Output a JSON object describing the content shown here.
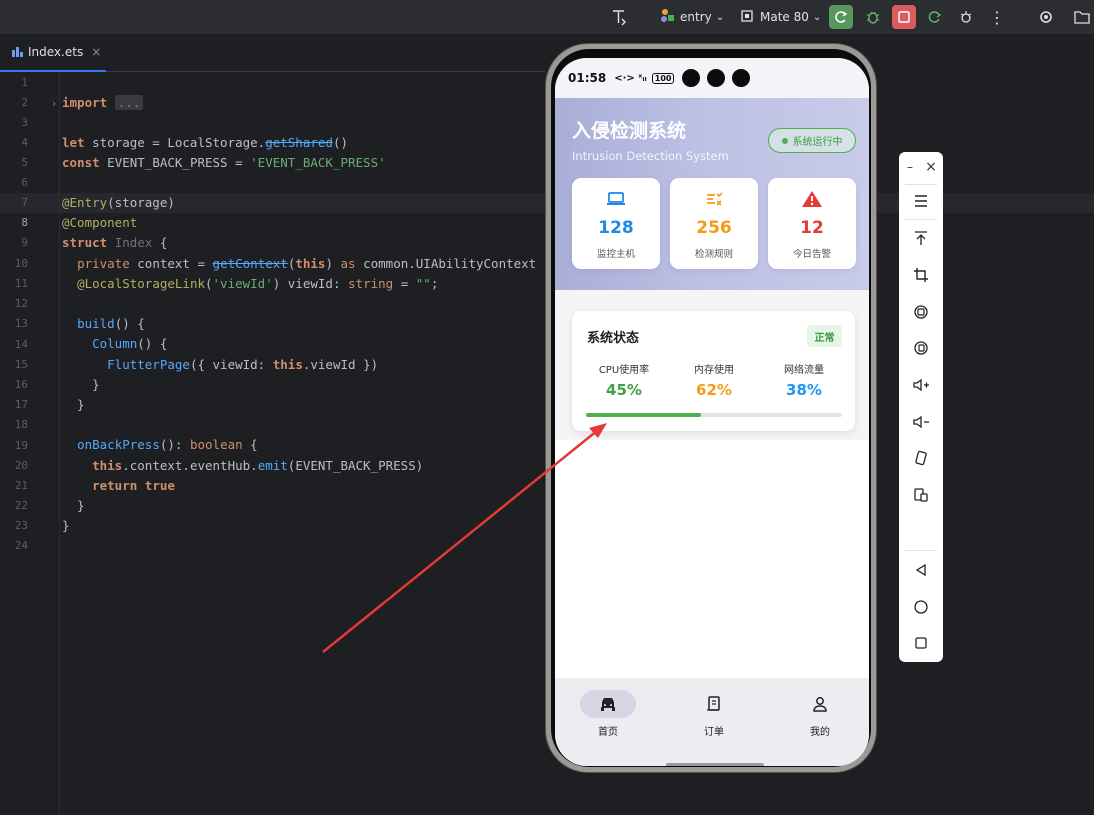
{
  "toolbar": {
    "module": "entry",
    "device": "Mate 80",
    "icons": [
      "text-tool-icon",
      "module-icon",
      "device-icon",
      "run-icon",
      "debug-icon",
      "stop-icon",
      "apply-changes-icon",
      "profiler-icon",
      "more-icon",
      "settings-icon",
      "folder-icon"
    ]
  },
  "editor": {
    "tab": {
      "label": "Index.ets",
      "close": "×"
    },
    "fold_placeholder": "...",
    "line_numbers": [
      "1",
      "2",
      "3",
      "4",
      "5",
      "6",
      "7",
      "8",
      "9",
      "10",
      "11",
      "12",
      "13",
      "14",
      "15",
      "16",
      "17",
      "18",
      "19",
      "20",
      "21",
      "22",
      "23",
      "24"
    ]
  },
  "phone": {
    "status": {
      "time": "01:58",
      "icons": "<·> ˣᵢₗ",
      "battery": "100"
    },
    "header": {
      "title": "入侵检测系统",
      "subtitle": "Intrusion Detection System",
      "running_badge": "系统运行中"
    },
    "stats": [
      {
        "icon": "laptop-icon",
        "value": "128",
        "label": "监控主机",
        "color": "#1e88e5"
      },
      {
        "icon": "rules-icon",
        "value": "256",
        "label": "检测规则",
        "color": "#f39c12"
      },
      {
        "icon": "warning-icon",
        "value": "12",
        "label": "今日告警",
        "color": "#e53935"
      }
    ],
    "system_status": {
      "title": "系统状态",
      "badge": "正常",
      "metrics": [
        {
          "label": "CPU使用率",
          "value": "45%",
          "color": "#43a047"
        },
        {
          "label": "内存使用",
          "value": "62%",
          "color": "#f39c12"
        },
        {
          "label": "网络流量",
          "value": "38%",
          "color": "#2196f3"
        }
      ],
      "progress": 0.45
    },
    "bottom_nav": [
      {
        "icon": "car-icon",
        "label": "首页",
        "active": true
      },
      {
        "icon": "receipt-icon",
        "label": "订单",
        "active": false
      },
      {
        "icon": "person-icon",
        "label": "我的",
        "active": false
      }
    ]
  },
  "side_panel": {
    "minimize": "–",
    "close": "×",
    "tools": [
      "menu-icon",
      "pin-top-icon",
      "crop-icon",
      "rotate-left-icon",
      "rotate-right-icon",
      "volume-up-icon",
      "volume-down-icon",
      "shake-icon",
      "multi-device-icon",
      "back-icon",
      "home-icon",
      "recent-apps-icon"
    ]
  },
  "colors": {
    "accent": "#3574f0",
    "arrow": "#e53935"
  }
}
